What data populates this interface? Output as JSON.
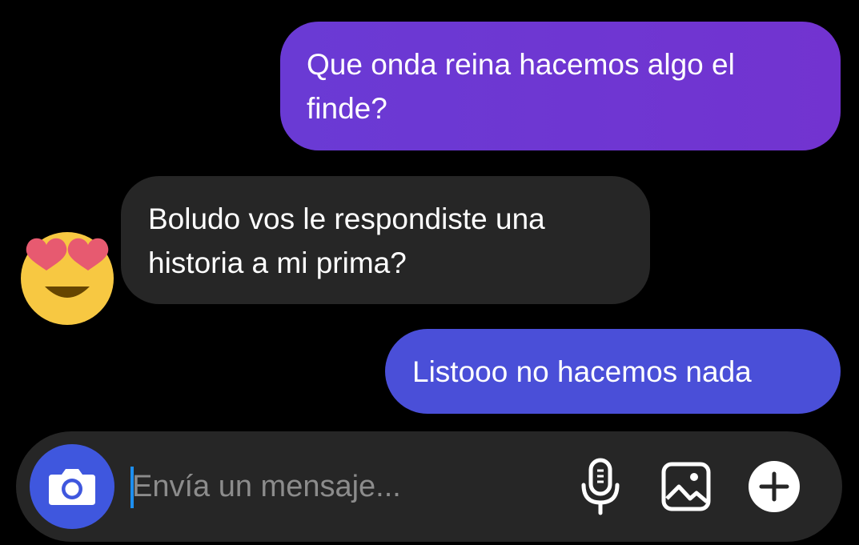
{
  "messages": [
    {
      "direction": "sent",
      "lines": [
        "Que onda reina hacemos algo el",
        "finde?"
      ],
      "color": "#6a3ad4"
    },
    {
      "direction": "received",
      "lines": [
        "Boludo vos le respondiste una",
        "historia a mi prima?"
      ],
      "avatar_icon": "heart-eyes-emoji-icon",
      "color": "#262626"
    },
    {
      "direction": "sent",
      "lines": [
        "Listooo no hacemos nada"
      ],
      "color": "#4a4fd8"
    }
  ],
  "composer": {
    "placeholder": "Envía un mensaje...",
    "value": "",
    "camera_icon": "camera-icon",
    "mic_icon": "microphone-icon",
    "gallery_icon": "image-gallery-icon",
    "more_icon": "plus-icon",
    "accent_color": "#3f57de",
    "caret_color": "#1d8ff0"
  }
}
